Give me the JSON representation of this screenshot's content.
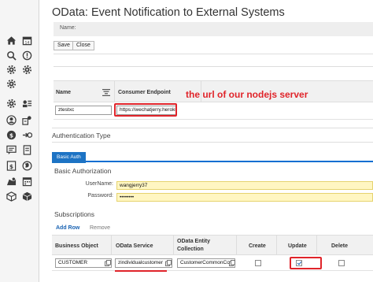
{
  "rail": {
    "icons": [
      "home-icon",
      "calendar-icon",
      "search-icon",
      "alert-icon",
      "settings-icon",
      "settings-icon-2",
      "settings-icon-3",
      "list-settings-icon",
      "user-icon",
      "user-settings-icon",
      "currency-icon",
      "transfer-icon",
      "feedback-icon",
      "document-icon",
      "dollar-icon",
      "globe-icon",
      "map-pin-icon",
      "calendar-grid-icon",
      "box-icon",
      "cube-icon"
    ]
  },
  "page": {
    "title": "OData: Event Notification to External Systems",
    "name_label": "Name:"
  },
  "toolbar": {
    "save_label": "Save",
    "close_label": "Close"
  },
  "endpoint_table": {
    "col_name": "Name",
    "col_endpoint": "Consumer Endpoint",
    "row": {
      "name": "ztestxc",
      "endpoint": "https://wechatjerry.heroku"
    }
  },
  "annotation": "the url of our nodejs server",
  "auth": {
    "section_title": "Authentication Type",
    "tab_label": "Basic Auth",
    "subsection_title": "Basic Authorization",
    "username_label": "UserName:",
    "username_value": "wangjerry37",
    "password_label": "Password:",
    "password_value": "••••••••"
  },
  "subscriptions": {
    "title": "Subscriptions",
    "add_row_label": "Add Row",
    "remove_label": "Remove",
    "columns": {
      "business_object": "Business Object",
      "odata_service": "OData Service",
      "odata_entity_line1": "OData Entity",
      "odata_entity_line2": "Collection",
      "create": "Create",
      "update": "Update",
      "delete": "Delete"
    },
    "row": {
      "business_object": "CUSTOMER",
      "odata_service": "zindividualcustomer",
      "odata_entity": "CustomerCommonCo",
      "create": false,
      "update": true,
      "delete": false
    }
  },
  "colors": {
    "accent": "#1d73c4",
    "annotation_red": "#e0242a",
    "required_field": "#fff6c2"
  }
}
